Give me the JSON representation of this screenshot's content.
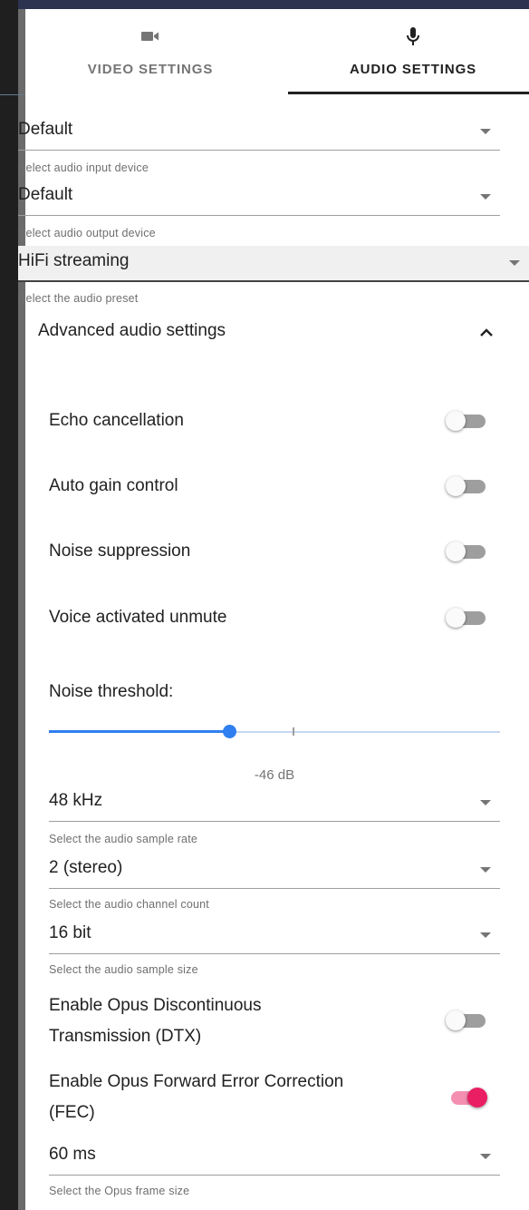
{
  "tabs": {
    "video": {
      "label": "VIDEO SETTINGS",
      "icon": "videocam-icon",
      "selected": false
    },
    "audio": {
      "label": "AUDIO SETTINGS",
      "icon": "microphone-icon",
      "selected": true
    }
  },
  "audio_input": {
    "value": "Default",
    "helper": "Select audio input device"
  },
  "audio_output": {
    "value": "Default",
    "helper": "Select audio output device"
  },
  "audio_preset": {
    "value": "HiFi streaming",
    "helper": "Select the audio preset"
  },
  "advanced": {
    "title": "Advanced audio settings",
    "expanded": true,
    "echo_cancellation": {
      "label": "Echo cancellation",
      "on": false
    },
    "auto_gain_control": {
      "label": "Auto gain control",
      "on": false
    },
    "noise_suppression": {
      "label": "Noise suppression",
      "on": false
    },
    "voice_activated_unmute": {
      "label": "Voice activated unmute",
      "on": false
    },
    "noise_threshold": {
      "label": "Noise threshold:",
      "value_text": "-46 dB",
      "position_fraction": 0.4,
      "mark_fraction": 0.54
    },
    "sample_rate": {
      "value": "48 kHz",
      "helper": "Select the audio sample rate"
    },
    "channel_count": {
      "value": "2 (stereo)",
      "helper": "Select the audio channel count"
    },
    "sample_size": {
      "value": "16 bit",
      "helper": "Select the audio sample size"
    },
    "opus_dtx": {
      "label_line1": "Enable Opus Discontinuous",
      "label_line2": "Transmission (DTX)",
      "on": false
    },
    "opus_fec": {
      "label_line1": "Enable Opus Forward Error Correction",
      "label_line2": "(FEC)",
      "on": true
    },
    "frame_size": {
      "value": "60 ms",
      "helper": "Select the Opus frame size"
    }
  },
  "colors": {
    "accent_pink": "#e91e63",
    "slider_blue": "#2f7ff0",
    "tab_selected": "#212121"
  }
}
